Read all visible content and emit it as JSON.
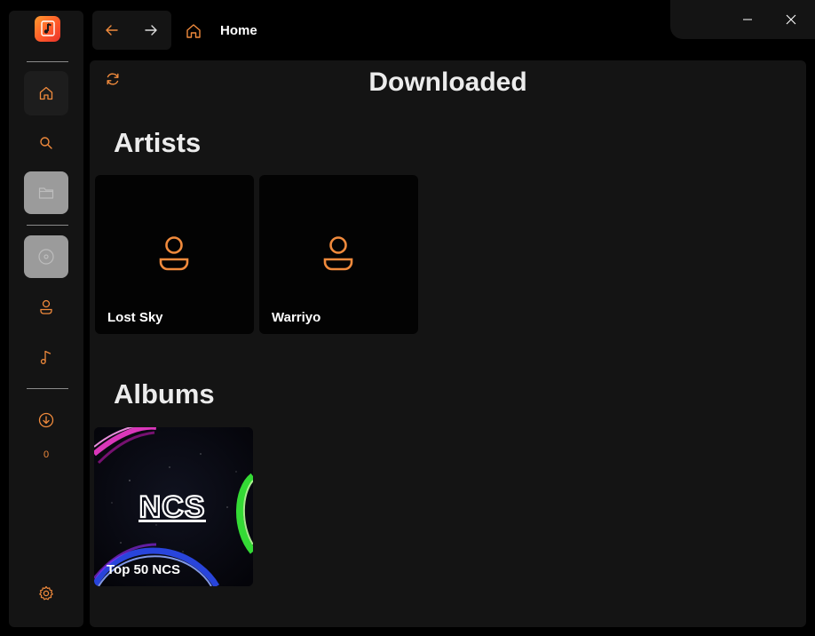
{
  "window": {
    "minimize_icon": "minimize-icon",
    "close_icon": "close-icon"
  },
  "sidebar": {
    "logo_icon": "app-logo-music-icon",
    "items": [
      {
        "name": "home",
        "icon": "home-icon",
        "state": "active"
      },
      {
        "name": "search",
        "icon": "search-icon",
        "state": "normal"
      },
      {
        "name": "folders",
        "icon": "folder-icon",
        "state": "disabled"
      },
      {
        "name": "albums",
        "icon": "disc-icon",
        "state": "disabled"
      },
      {
        "name": "artists",
        "icon": "person-icon",
        "state": "normal"
      },
      {
        "name": "songs",
        "icon": "music-note-icon",
        "state": "normal"
      },
      {
        "name": "downloads",
        "icon": "download-icon",
        "state": "normal"
      },
      {
        "name": "settings",
        "icon": "gear-icon",
        "state": "normal"
      }
    ],
    "download_count": "0"
  },
  "topnav": {
    "back_icon": "arrow-left-icon",
    "forward_icon": "arrow-right-icon",
    "home_icon": "home-icon",
    "title": "Home"
  },
  "main": {
    "refresh_icon": "refresh-icon",
    "title": "Downloaded",
    "artists_heading": "Artists",
    "artists": [
      {
        "name": "Lost Sky",
        "icon": "person-icon"
      },
      {
        "name": "Warriyo",
        "icon": "person-icon"
      }
    ],
    "albums_heading": "Albums",
    "albums": [
      {
        "name": "Top 50 NCS",
        "art_text": "NCS"
      }
    ]
  },
  "colors": {
    "accent": "#f08a3c",
    "background": "#000000",
    "panel": "#141414",
    "card": "#030303",
    "disabled": "#9b9b9b"
  }
}
